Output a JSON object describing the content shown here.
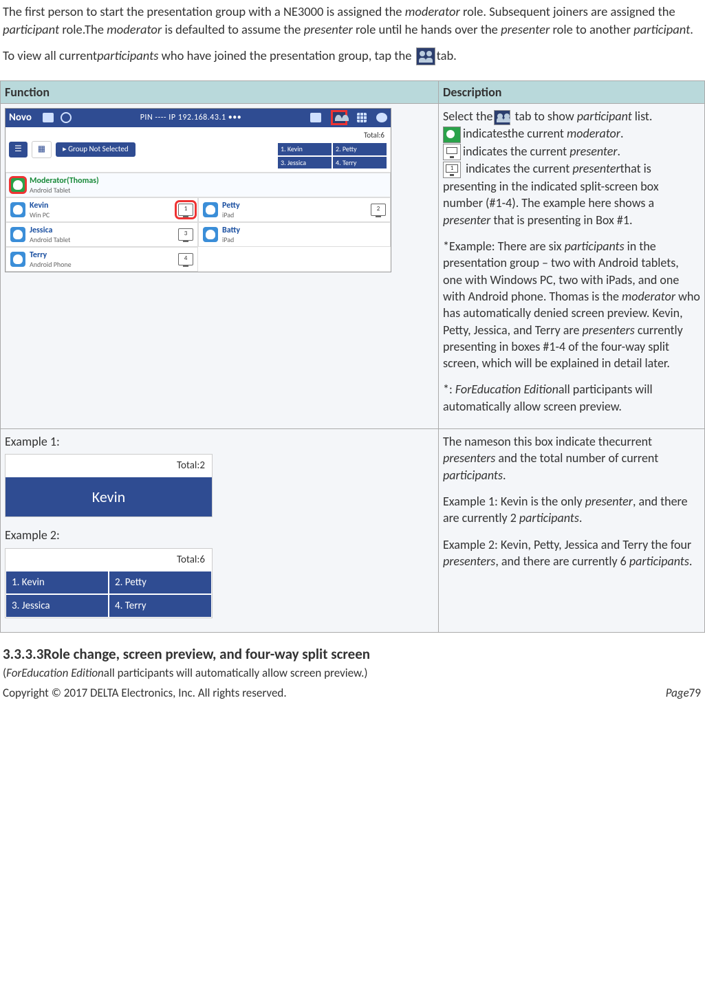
{
  "intro": {
    "p1_a": "The first person to start the presentation group with a NE3000 is assigned the ",
    "p1_b": " role. Subsequent joiners are assigned the ",
    "p1_c": " role.The ",
    "p1_d": " is defaulted to assume the ",
    "p1_e": " role until he hands over the ",
    "p1_f": " role to another ",
    "p1_g": ".",
    "p2_a": "To view all current",
    "p2_b": " who have joined the presentation group, tap the ",
    "p2_c": "tab.",
    "moderator": "moderator",
    "participant": "participant",
    "presenter": "presenter",
    "participants": "participants"
  },
  "table": {
    "h1": "Function",
    "h2": "Description"
  },
  "novo": {
    "brand": "Novo",
    "pinip": "PIN ---- IP 192.168.43.1  •••",
    "group_btn": "▸ Group Not Selected",
    "total_label": "Total:6",
    "mini": {
      "c1": "1. Kevin",
      "c2": "2. Petty",
      "c3": "3. Jessica",
      "c4": "4. Terry"
    },
    "rows": {
      "mod_name": "Moderator(Thomas)",
      "mod_dev": "Android Tablet",
      "kevin": "Kevin",
      "kevin_dev": "Win PC",
      "petty": "Petty",
      "petty_dev": "iPad",
      "jessica": "Jessica",
      "jessica_dev": "Android Tablet",
      "batty": "Batty",
      "batty_dev": "iPad",
      "terry": "Terry",
      "terry_dev": "Android Phone"
    }
  },
  "desc1": {
    "l1a": "Select the",
    "l1b": " tab to show ",
    "l1c": " list.",
    "l2a": "indicatesthe current ",
    "l2b": ".",
    "l3a": "indicates the current ",
    "l3b": ".",
    "l4a": " indicates the current ",
    "l4b": "that is presenting in the indicated split-screen box number (#1-4). The example here shows a ",
    "l4c": " that is presenting in Box #1.",
    "ex_a": "*Example: There are six ",
    "ex_b": " in the presentation group – two with Android tablets, one with Windows PC, two with iPads, and one with Android phone. Thomas is the ",
    "ex_c": " who has automatically denied screen preview. Kevin, Petty, Jessica, and Terry are ",
    "ex_d": " currently presenting in boxes #1-4 of the four-way split screen, which will be explained in detail later.",
    "edu_a": "*: ",
    "edu_b": "ForEducation Edition",
    "edu_c": "all participants will automatically allow screen preview.",
    "participant": "participant",
    "moderator": "moderator",
    "presenter": "presenter",
    "presenters": "presenters",
    "participants": "participants"
  },
  "row2": {
    "ex1_label": "Example 1:",
    "ex1_total": "Total:2",
    "ex1_name": "Kevin",
    "ex2_label": "Example 2:",
    "ex2_total": "Total:6",
    "q1": "1. Kevin",
    "q2": "2. Petty",
    "q3": "3. Jessica",
    "q4": "4. Terry"
  },
  "desc2": {
    "p1a": "The nameson this box indicate thecurrent ",
    "p1b": " and the total number of current ",
    "p1c": ".",
    "p2a": "Example 1: Kevin is the only ",
    "p2b": ", and there are currently 2 ",
    "p2c": ".",
    "p3a": "Example 2: Kevin, Petty, Jessica and Terry the four ",
    "p3b": ", and there are currently 6 ",
    "p3c": ".",
    "presenters": "presenters",
    "participants": "participants",
    "presenter": "presenter"
  },
  "heading": "3.3.3.3Role change, screen preview, and four-way split screen",
  "note": {
    "a": "(",
    "b": "ForEducation Edition",
    "c": "all participants will automatically allow screen preview.)"
  },
  "footer": {
    "left": "Copyright © 2017 DELTA Electronics, Inc. All rights reserved.",
    "right_label": "Page",
    "right_num": "79"
  }
}
